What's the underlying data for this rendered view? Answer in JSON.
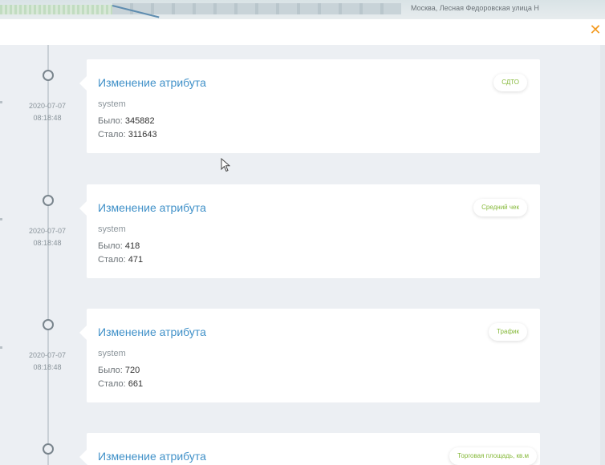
{
  "map": {
    "text": "Москва, Лесная Федоровская улица Н"
  },
  "modal": {
    "close_symbol": "✕",
    "accent_color": "#f39b22"
  },
  "events": [
    {
      "title": "Изменение атрибута",
      "user": "system",
      "date": "2020-07-07",
      "time": "08:18:48",
      "was_label": "Было:",
      "was_value": "345882",
      "now_label": "Стало:",
      "now_value": "311643",
      "badge": "СДТО"
    },
    {
      "title": "Изменение атрибута",
      "user": "system",
      "date": "2020-07-07",
      "time": "08:18:48",
      "was_label": "Было:",
      "was_value": "418",
      "now_label": "Стало:",
      "now_value": "471",
      "badge": "Средний чек"
    },
    {
      "title": "Изменение атрибута",
      "user": "system",
      "date": "2020-07-07",
      "time": "08:18:48",
      "was_label": "Было:",
      "was_value": "720",
      "now_label": "Стало:",
      "now_value": "661",
      "badge": "Трафик"
    },
    {
      "title": "Изменение атрибута",
      "badge": "Торговая площадь, кв.м"
    }
  ],
  "colors": {
    "title_link": "#3f90c8",
    "badge_text": "#86b93a"
  }
}
